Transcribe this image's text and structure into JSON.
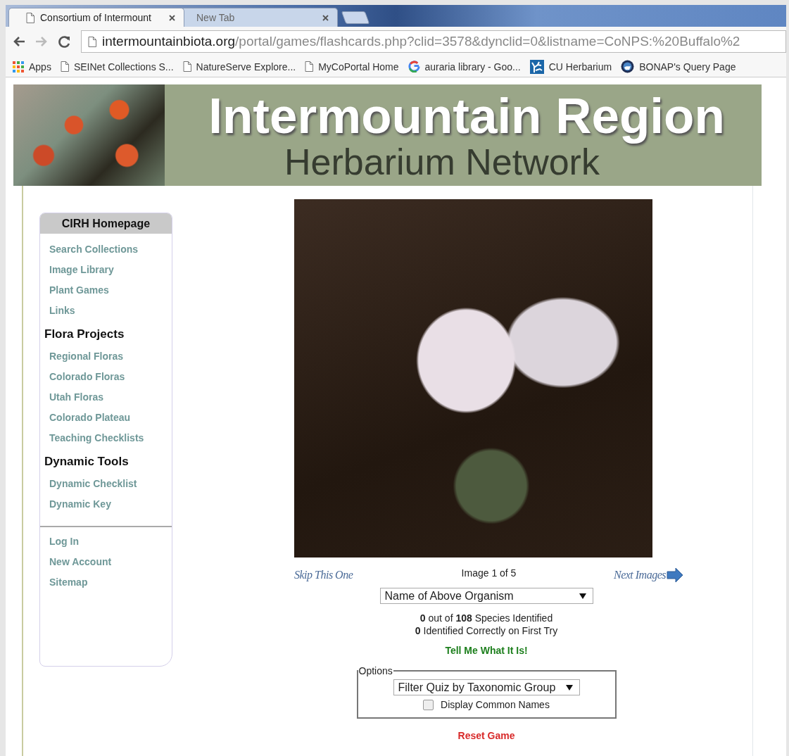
{
  "browser": {
    "tabs": [
      {
        "title": "Consortium of Intermount",
        "selected": true
      },
      {
        "title": "New Tab",
        "selected": false
      }
    ],
    "url": {
      "domain": "intermountainbiota.org",
      "path": "/portal/games/flashcards.php?clid=3578&dynclid=0&listname=CoNPS:%20Buffalo%2"
    },
    "bookmarks": [
      {
        "kind": "apps",
        "label": "Apps"
      },
      {
        "kind": "page",
        "label": "SEINet Collections S..."
      },
      {
        "kind": "page",
        "label": "NatureServe Explore..."
      },
      {
        "kind": "page",
        "label": "MyCoPortal Home"
      },
      {
        "kind": "google",
        "label": "auraria library - Goo..."
      },
      {
        "kind": "herbarium",
        "label": "CU Herbarium"
      },
      {
        "kind": "globe",
        "label": "BONAP's Query Page"
      }
    ]
  },
  "banner": {
    "title": "Intermountain Region",
    "subtitle": "Herbarium Network"
  },
  "sidebar": {
    "header": "CIRH Homepage",
    "entries": [
      {
        "kind": "link",
        "label": "Search Collections"
      },
      {
        "kind": "link",
        "label": "Image Library"
      },
      {
        "kind": "link",
        "label": "Plant Games"
      },
      {
        "kind": "link",
        "label": "Links"
      },
      {
        "kind": "heading",
        "label": "Flora Projects"
      },
      {
        "kind": "link",
        "label": "Regional Floras"
      },
      {
        "kind": "link",
        "label": "Colorado Floras"
      },
      {
        "kind": "link",
        "label": "Utah Floras"
      },
      {
        "kind": "link",
        "label": "Colorado Plateau"
      },
      {
        "kind": "link",
        "label": "Teaching Checklists"
      },
      {
        "kind": "heading",
        "label": "Dynamic Tools"
      },
      {
        "kind": "link",
        "label": "Dynamic Checklist"
      },
      {
        "kind": "link",
        "label": "Dynamic Key"
      },
      {
        "kind": "divider"
      },
      {
        "kind": "link",
        "label": "Log In"
      },
      {
        "kind": "link",
        "label": "New Account"
      },
      {
        "kind": "link",
        "label": "Sitemap"
      }
    ]
  },
  "game": {
    "skip_link": "Skip This One",
    "counter": "Image 1 of 5",
    "next_link": "Next Images",
    "answer_select": "Name of Above Organism",
    "stats": [
      "**0** out of **108** Species Identified",
      "**0** Identified Correctly on First Try"
    ],
    "reveal_link": "Tell Me What It Is!",
    "options": {
      "legend": "Options",
      "filter_select": "Filter Quiz by Taxonomic Group",
      "common_names": {
        "label": "Display Common Names",
        "checked": false
      }
    },
    "reset_link": "Reset Game"
  }
}
